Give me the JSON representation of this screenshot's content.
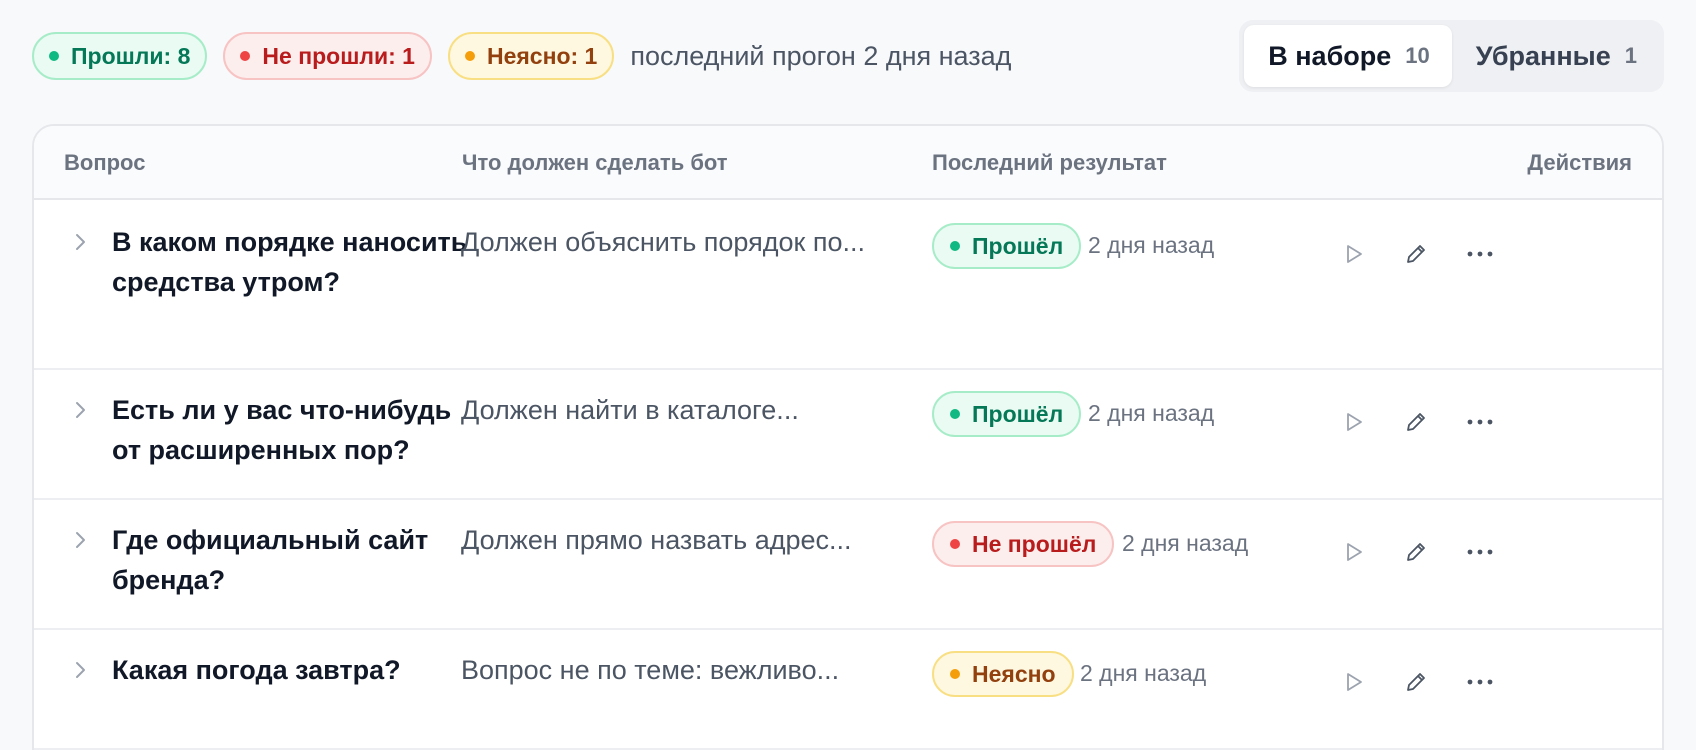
{
  "summary": {
    "passed_label": "Прошли: 8",
    "failed_label": "Не прошли: 1",
    "unclear_label": "Неясно: 1",
    "last_run": "последний прогон 2 дня назад"
  },
  "segments": [
    {
      "label": "В наборе",
      "count": "10",
      "active": true
    },
    {
      "label": "Убранные",
      "count": "1",
      "active": false
    }
  ],
  "table": {
    "columns": [
      "Вопрос",
      "Что должен сделать бот",
      "Последний результат",
      "Действия"
    ],
    "rows": [
      {
        "question": "В каком порядке наносить средства утром?",
        "expected": "Должен объяснить порядок по...",
        "status": "Прошёл",
        "status_kind": "pass",
        "when": "2 дня назад"
      },
      {
        "question": "Есть ли у вас что-нибудь от расширенных пор?",
        "expected": "Должен найти в каталоге...",
        "status": "Прошёл",
        "status_kind": "pass",
        "when": "2 дня назад"
      },
      {
        "question": "Где официальный сайт бренда?",
        "expected": "Должен прямо назвать адрес...",
        "status": "Не прошёл",
        "status_kind": "fail",
        "when": "2 дня назад"
      },
      {
        "question": "Какая погода завтра?",
        "expected": "Вопрос не по теме: вежливо...",
        "status": "Неясно",
        "status_kind": "unclear",
        "when": "2 дня назад"
      }
    ]
  },
  "icons": {
    "expand": "chevron-right-icon",
    "run": "play-icon",
    "edit": "pencil-icon",
    "more": "more-horizontal-icon"
  },
  "colors": {
    "pass": "#10b981",
    "fail": "#ef4444",
    "unclear": "#f59e0b"
  }
}
